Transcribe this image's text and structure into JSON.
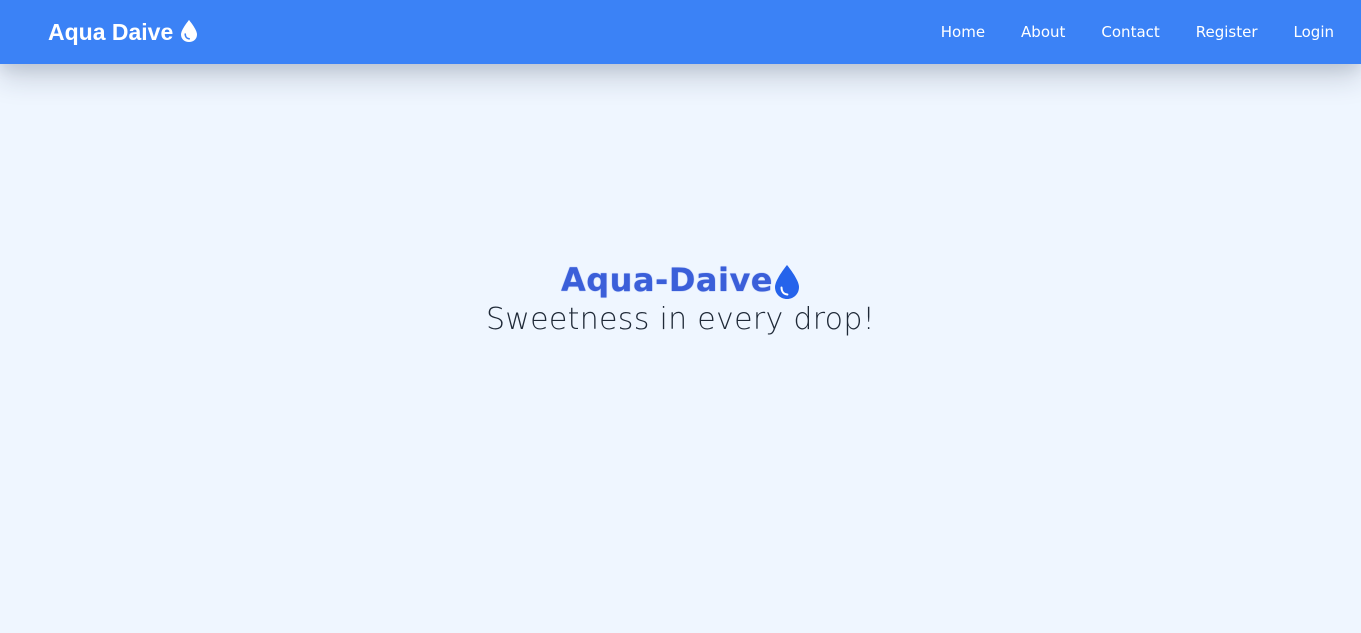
{
  "navbar": {
    "brand_label": "Aqua Daive",
    "brand_icon": "water-drop-icon",
    "links": [
      {
        "label": "Home"
      },
      {
        "label": "About"
      },
      {
        "label": "Contact"
      },
      {
        "label": "Register"
      },
      {
        "label": "Login"
      }
    ]
  },
  "hero": {
    "title": "Aqua-Daive",
    "title_icon": "water-drop-icon",
    "tagline": "Sweetness in every drop!"
  },
  "colors": {
    "navbar_bg": "#3b82f6",
    "page_bg": "#eff6ff",
    "hero_title": "#3b5fd9",
    "tagline": "#1f2937"
  }
}
